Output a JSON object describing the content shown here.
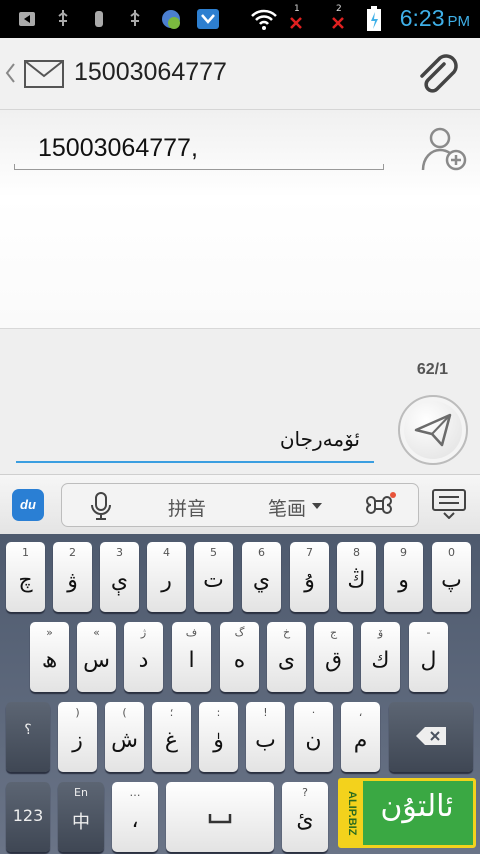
{
  "status_bar": {
    "time": "6:23",
    "ampm": "PM",
    "signal1_label": "1",
    "signal2_label": "2",
    "icons": [
      "back-icon",
      "usb-icon",
      "usb-debug-icon",
      "usb-icon",
      "android-icon",
      "shield-icon",
      "wifi-icon",
      "sim1-no-signal-icon",
      "sim2-no-signal-icon",
      "battery-charging-icon"
    ]
  },
  "action_bar": {
    "title": "15003064777",
    "icons": [
      "back-chevron-icon",
      "envelope-icon",
      "paperclip-icon"
    ]
  },
  "recipients": {
    "value": "15003064777,",
    "add_icon": "add-contact-icon"
  },
  "compose": {
    "counter": "62/1",
    "message": "ئۆمەرجان",
    "send_icon": "send-icon"
  },
  "ime_bar": {
    "logo_text": "du",
    "pinyin_label": "拼音",
    "stroke_label": "笔画",
    "icons": [
      "microphone-icon",
      "command-icon",
      "hide-keyboard-icon"
    ],
    "notification_dot_color": "#e8543a"
  },
  "keyboard": {
    "row1": [
      {
        "hint": "1",
        "char": "چ"
      },
      {
        "hint": "2",
        "char": "ۋ"
      },
      {
        "hint": "3",
        "char": "ې"
      },
      {
        "hint": "4",
        "char": "ر"
      },
      {
        "hint": "5",
        "char": "ت"
      },
      {
        "hint": "6",
        "char": "ي"
      },
      {
        "hint": "7",
        "char": "ۇ"
      },
      {
        "hint": "8",
        "char": "ڭ"
      },
      {
        "hint": "9",
        "char": "و"
      },
      {
        "hint": "0",
        "char": "پ"
      }
    ],
    "row2": [
      {
        "hint": "»",
        "char": "ھ"
      },
      {
        "hint": "«",
        "char": "س"
      },
      {
        "hint": "ژ",
        "char": "د"
      },
      {
        "hint": "ف",
        "char": "ا"
      },
      {
        "hint": "گ",
        "char": "ە"
      },
      {
        "hint": "خ",
        "char": "ى"
      },
      {
        "hint": "ج",
        "char": "ق"
      },
      {
        "hint": "ۆ",
        "char": "ك"
      },
      {
        "hint": "-",
        "char": "ل"
      }
    ],
    "row3": [
      {
        "hint": ")",
        "char": "ز"
      },
      {
        "hint": "(",
        "char": "ش"
      },
      {
        "hint": "؛",
        "char": "غ"
      },
      {
        "hint": ":",
        "char": "ۈ"
      },
      {
        "hint": "!",
        "char": "ب"
      },
      {
        "hint": "·",
        "char": "ن"
      },
      {
        "hint": "،",
        "char": "م"
      }
    ],
    "row3_left_hint": "؟",
    "backspace_icon": "backspace-icon",
    "row4": {
      "num_label": "123",
      "lang_hint": "En",
      "lang_label": "中",
      "comma_hint": "…",
      "comma_char": "،",
      "space_icon": "space-icon",
      "punct_hint": "?",
      "punct_char": "ئ"
    }
  },
  "watermark": {
    "side_text": "ALIP.BIZ",
    "main_text": "ئالتۇن"
  }
}
